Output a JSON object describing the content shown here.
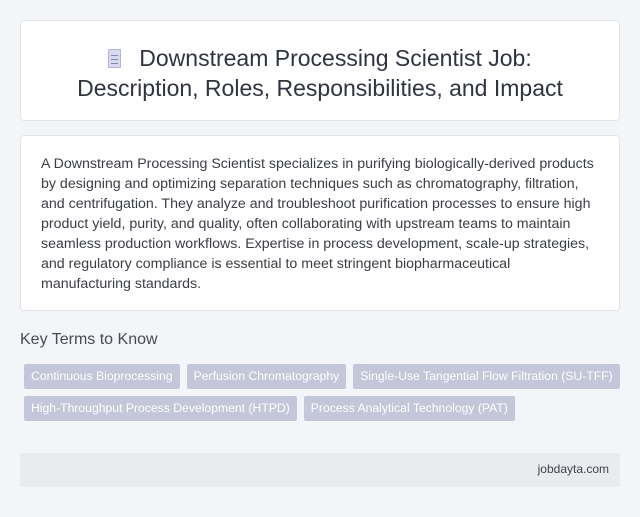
{
  "header": {
    "icon": "document-icon",
    "title_line1": "Downstream Processing Scientist Job:",
    "title_line2": "Description, Roles, Responsibilities, and Impact"
  },
  "description": "A Downstream Processing Scientist specializes in purifying biologically-derived products by designing and optimizing separation techniques such as chromatography, filtration, and centrifugation. They analyze and troubleshoot purification processes to ensure high product yield, purity, and quality, often collaborating with upstream teams to maintain seamless production workflows. Expertise in process development, scale-up strategies, and regulatory compliance is essential to meet stringent biopharmaceutical manufacturing standards.",
  "key_terms": {
    "title": "Key Terms to Know",
    "row1": [
      "Continuous Bioprocessing",
      "Perfusion Chromatography",
      "Single-Use Tangential Flow Filtration (SU-TFF)"
    ],
    "row2": [
      "High-Throughput Process Development (HTPD)",
      "Process Analytical Technology (PAT)"
    ]
  },
  "footer": {
    "site": "jobdayta.com"
  }
}
